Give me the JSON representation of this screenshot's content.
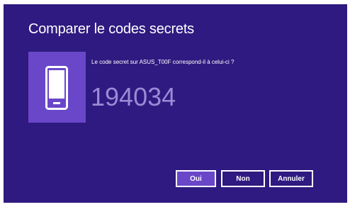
{
  "dialog": {
    "title": "Comparer le codes secrets",
    "prompt": "Le code secret sur ASUS_T00F correspond-il à celui-ci ?",
    "code": "194034",
    "icon": "phone-icon"
  },
  "buttons": {
    "oui": "Oui",
    "non": "Non",
    "annuler": "Annuler"
  },
  "colors": {
    "background": "#2e1a80",
    "accent": "#6a46c9",
    "code_text": "#9a8bd6"
  }
}
